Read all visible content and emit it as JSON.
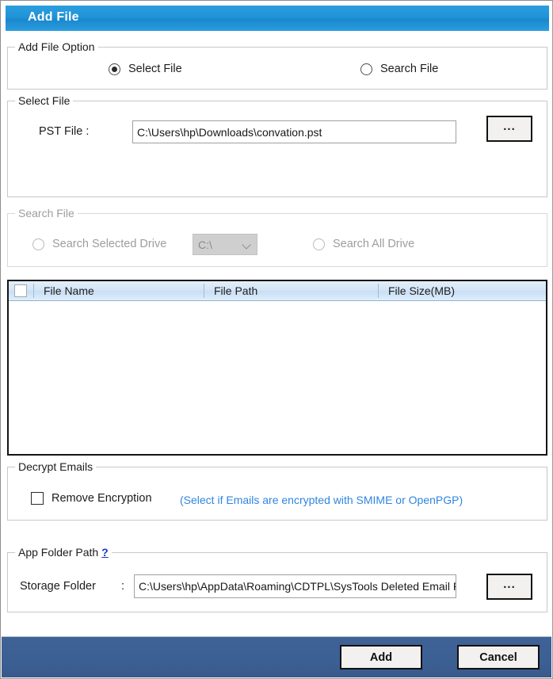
{
  "window": {
    "title": "Add File"
  },
  "add_file_option": {
    "legend": "Add File Option",
    "options": [
      {
        "label": "Select File",
        "checked": true
      },
      {
        "label": "Search File",
        "checked": false
      }
    ]
  },
  "select_file": {
    "legend": "Select File",
    "pst_label": "PST File :",
    "pst_value": "C:\\Users\\hp\\Downloads\\convation.pst",
    "browse_label": "..."
  },
  "search_file": {
    "legend": "Search File",
    "disabled": true,
    "selected_drive_label": "Search Selected Drive",
    "drive_value": "C:\\",
    "all_drive_label": "Search All Drive"
  },
  "grid": {
    "select_all_checked": false,
    "columns": [
      "File Name",
      "File Path",
      "File Size(MB)"
    ],
    "rows": []
  },
  "decrypt_emails": {
    "legend": "Decrypt Emails",
    "checkbox_label": "Remove Encryption",
    "checkbox_checked": false,
    "hint": "(Select if Emails are encrypted with SMIME or OpenPGP)"
  },
  "app_folder_path": {
    "legend": "App Folder Path",
    "help_glyph": "?",
    "storage_label": "Storage Folder",
    "storage_separator": ":",
    "storage_value": "C:\\Users\\hp\\AppData\\Roaming\\CDTPL\\SysTools Deleted Email Recovery",
    "browse_label": "..."
  },
  "footer": {
    "add_label": "Add",
    "cancel_label": "Cancel"
  },
  "colors": {
    "title_blue": "#2094d8",
    "footer_blue": "#3c6094",
    "hint_blue": "#2f86e0",
    "link_blue": "#1436c8"
  }
}
